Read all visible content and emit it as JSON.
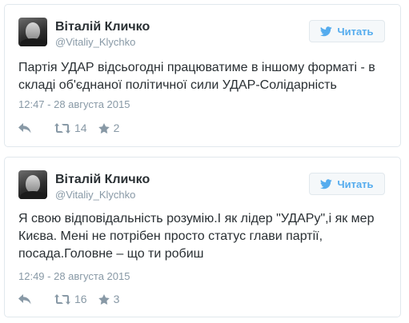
{
  "tweets": [
    {
      "author_name": "Віталій Кличко",
      "handle": "@Vitaliy_Klychko",
      "follow_label": "Читать",
      "text": "Партія УДАР відсьогодні працюватиме в іншому форматі - в складі об'єднаної політичної сили УДАР-Солідарність",
      "date": "12:47 - 28 августа 2015",
      "retweets": "14",
      "favorites": "2"
    },
    {
      "author_name": "Віталій Кличко",
      "handle": "@Vitaliy_Klychko",
      "follow_label": "Читать",
      "text": "Я свою відповідальність розумію.І як лідер \"УДАРу\",і як мер Києва. Мені не потрібен просто статус глави партії, посада.Головне – що ти робиш",
      "date": "12:49 - 28 августа 2015",
      "retweets": "16",
      "favorites": "3"
    }
  ],
  "icons": {
    "reply": "reply-icon",
    "retweet": "retweet-icon",
    "favorite": "star-icon",
    "follow": "twitter-bird-icon"
  },
  "colors": {
    "accent": "#55acee",
    "muted": "#8899a6",
    "text": "#292f33",
    "border": "#e1e8ed"
  }
}
